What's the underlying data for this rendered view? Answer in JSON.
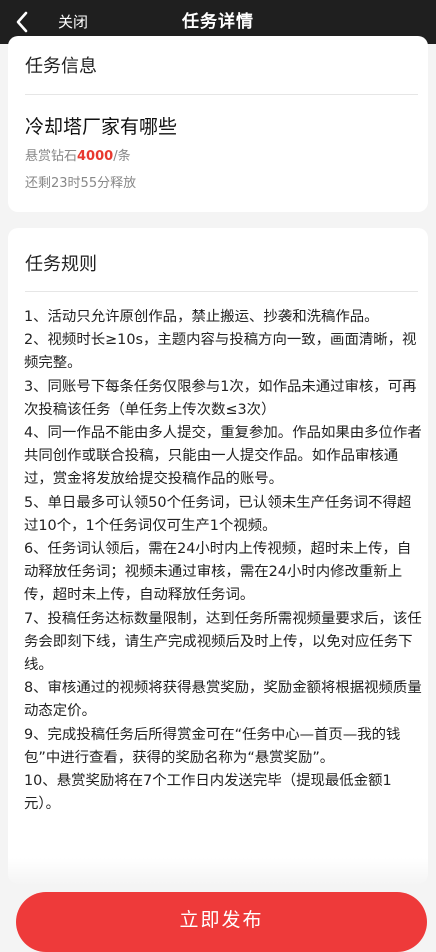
{
  "header": {
    "back_icon": "chevron-left-icon",
    "close_label": "关闭",
    "title": "任务详情"
  },
  "task_info": {
    "section_title": "任务信息",
    "name": "冷却塔厂家有哪些",
    "reward_prefix": "悬赏钻石",
    "reward_amount": "4000",
    "reward_suffix": "/条",
    "remaining": "还剩23时55分释放"
  },
  "rules": {
    "section_title": "任务规则",
    "items": [
      "1、活动只允许原创作品，禁止搬运、抄袭和洗稿作品。",
      "2、视频时长≥10s，主题内容与投稿方向一致，画面清晰，视频完整。",
      "3、同账号下每条任务仅限参与1次，如作品未通过审核，可再次投稿该任务（单任务上传次数≤3次）",
      "4、同一作品不能由多人提交，重复参加。作品如果由多位作者共同创作或联合投稿，只能由一人提交作品。如作品审核通过，赏金将发放给提交投稿作品的账号。",
      "5、单日最多可认领50个任务词，已认领未生产任务词不得超过10个，1个任务词仅可生产1个视频。",
      "6、任务词认领后，需在24小时内上传视频，超时未上传，自动释放任务词；视频未通过审核，需在24小时内修改重新上传，超时未上传，自动释放任务词。",
      "7、投稿任务达标数量限制，达到任务所需视频量要求后，该任务会即刻下线，请生产完成视频后及时上传，以免对应任务下线。",
      "8、审核通过的视频将获得悬赏奖励，奖励金额将根据视频质量动态定价。",
      "9、完成投稿任务后所得赏金可在“任务中心—首页—我的钱包”中进行查看，获得的奖励名称为“悬赏奖励”。",
      "10、悬赏奖励将在7个工作日内发送完毕（提现最低金额1元）。"
    ]
  },
  "footer": {
    "publish_label": "立即发布"
  },
  "colors": {
    "accent": "#ee3a3a",
    "reward": "#e8392f",
    "header_bg": "#1f1f1f"
  }
}
